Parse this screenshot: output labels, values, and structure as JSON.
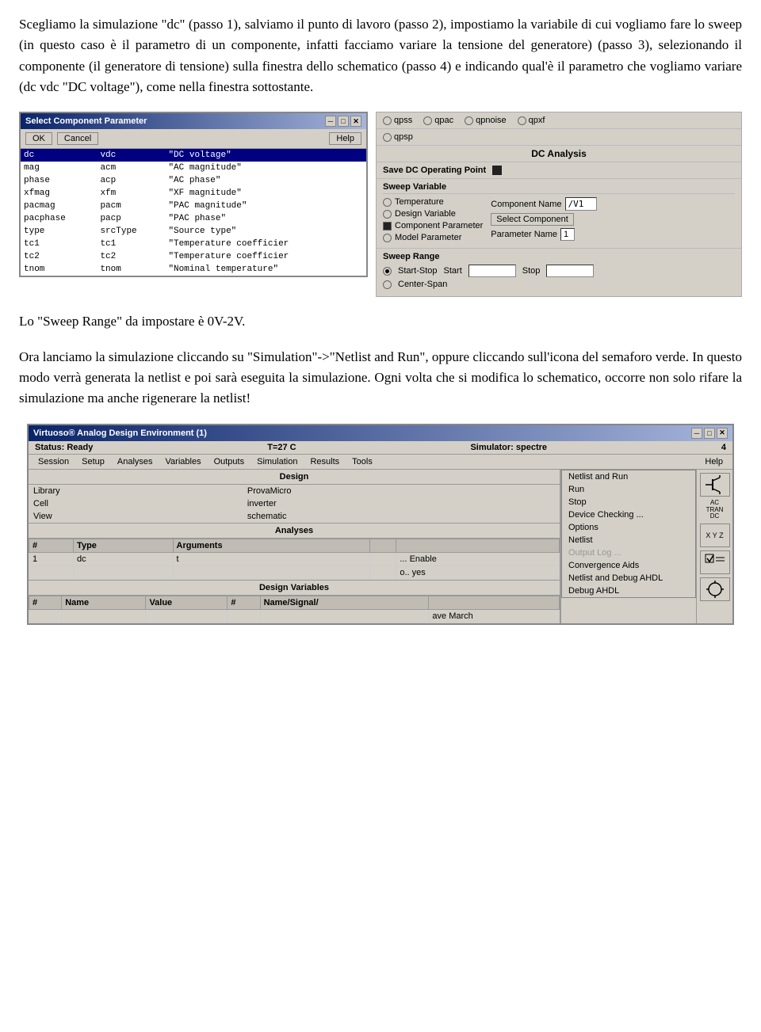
{
  "intro_text": "Scegliamo la simulazione \"dc\" (passo 1), salviamo il punto di lavoro (passo 2), impostiamo la variabile di cui vogliamo fare lo sweep (in questo caso è il parametro di un componente, infatti facciamo variare la tensione del generatore) (passo 3), selezionando il componente (il generatore di tensione) sulla finestra dello schematico (passo 4) e indicando qual'è il parametro che vogliamo variare (dc vdc \"DC voltage\"), come nella finestra sottostante.",
  "dialog": {
    "title": "Select Component Parameter",
    "buttons": [
      "OK",
      "Cancel",
      "Help"
    ],
    "titlebar_btns": [
      "-",
      "□",
      "✕"
    ],
    "columns": [
      "",
      "",
      ""
    ],
    "rows": [
      {
        "col1": "dc",
        "col2": "vdc",
        "col3": "\"DC voltage\"",
        "selected": true
      },
      {
        "col1": "mag",
        "col2": "acm",
        "col3": "\"AC magnitude\""
      },
      {
        "col1": "phase",
        "col2": "acp",
        "col3": "\"AC phase\""
      },
      {
        "col1": "xfmag",
        "col2": "xfm",
        "col3": "\"XF magnitude\""
      },
      {
        "col1": "pacmag",
        "col2": "pacm",
        "col3": "\"PAC magnitude\""
      },
      {
        "col1": "pacphase",
        "col2": "pacp",
        "col3": "\"PAC phase\""
      },
      {
        "col1": "type",
        "col2": "srcType",
        "col3": "\"Source type\""
      },
      {
        "col1": "tc1",
        "col2": "tc1",
        "col3": "\"Temperature coefficier"
      },
      {
        "col1": "tc2",
        "col2": "tc2",
        "col3": "\"Temperature coefficier"
      },
      {
        "col1": "tnom",
        "col2": "tnom",
        "col3": "\"Nominal temperature\""
      }
    ]
  },
  "right_panel": {
    "checkboxes": [
      "qpss",
      "qpac",
      "qpnoise",
      "qpxf",
      "qpsp"
    ],
    "section_title": "DC Analysis",
    "save_dc_label": "Save DC Operating Point",
    "sweep_variable_title": "Sweep Variable",
    "temperature_label": "Temperature",
    "design_variable_label": "Design Variable",
    "component_parameter_label": "Component Parameter",
    "model_parameter_label": "Model Parameter",
    "component_name_label": "Component Name",
    "component_name_value": "/V1",
    "select_component_btn": "Select Component",
    "parameter_name_label": "Parameter Name",
    "parameter_name_value": "1",
    "sweep_range_title": "Sweep Range",
    "start_stop_label": "Start-Stop",
    "center_span_label": "Center-Span",
    "start_label": "Start",
    "stop_label": "Stop"
  },
  "mid_text1": "Lo \"Sweep Range\" da impostare è 0V-2V.",
  "mid_text2": "Ora lanciamo la simulazione cliccando su \"Simulation\"->\"Netlist and Run\", oppure cliccando sull'icona del semaforo verde. In questo modo verrà generata la netlist e poi sarà eseguita la simulazione. Ogni volta che si modifica lo schematico, occorre non solo rifare la simulazione ma anche rigenerare la netlist!",
  "ade": {
    "title": "Virtuoso® Analog Design Environment (1)",
    "titlebar_btns": [
      "-",
      "□",
      "✕"
    ],
    "status": "Status: Ready",
    "temp": "T=27 C",
    "simulator": "Simulator: spectre",
    "sim_number": "4",
    "menu_items": [
      "Session",
      "Setup",
      "Analyses",
      "Variables",
      "Outputs",
      "Simulation",
      "Results",
      "Tools",
      "Help"
    ],
    "design_label": "Design",
    "library_label": "Library",
    "library_value": "ProvaMicro",
    "cell_label": "Cell",
    "cell_value": "inverter",
    "view_label": "View",
    "view_value": "schematic",
    "analyses_section": "Analyses",
    "analyses_headers": [
      "#",
      "Type",
      "Arguments",
      ""
    ],
    "analyses_rows": [
      {
        "num": "1",
        "type": "dc",
        "args": "t",
        "enabled": ""
      }
    ],
    "dv_section": "Design Variables",
    "dv_headers": [
      "#",
      "Name",
      "Value"
    ],
    "dv_rows": [],
    "outputs_section": "# Name/Signal/Expr",
    "simulation_menu": {
      "items": [
        {
          "label": "Netlist and Run",
          "dimmed": false
        },
        {
          "label": "Run",
          "dimmed": false
        },
        {
          "label": "Stop",
          "dimmed": false
        },
        {
          "label": "Device Checking ...",
          "dimmed": false
        },
        {
          "label": "Options",
          "dimmed": false
        },
        {
          "label": "Netlist",
          "dimmed": false
        },
        {
          "label": "Output Log ...",
          "dimmed": true
        },
        {
          "label": "Convergence Aids",
          "dimmed": false
        },
        {
          "label": "Netlist and Debug AHDL",
          "dimmed": false
        },
        {
          "label": "Debug AHDL",
          "dimmed": false
        }
      ]
    },
    "right_area_labels": [
      "ave March"
    ],
    "sidebar_btns": [
      "AC\nTRAN\nDC",
      "X Y Z",
      "↓✓",
      "🔧"
    ],
    "enable_label": "... Enable",
    "yes_label": "o.. yes"
  }
}
